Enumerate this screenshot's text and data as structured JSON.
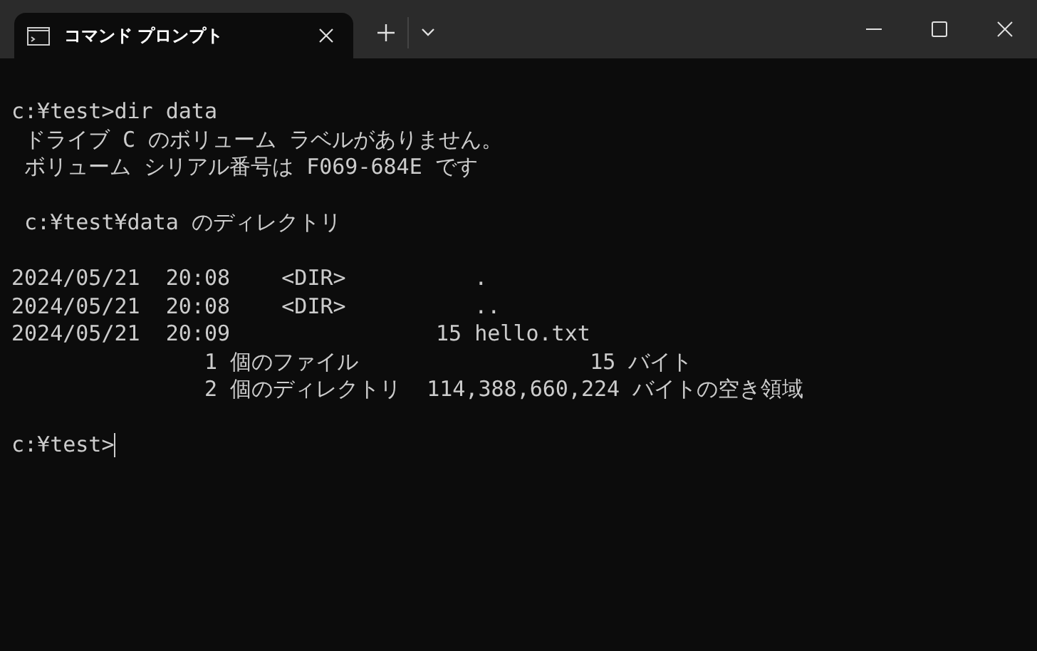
{
  "tabs": [
    {
      "title": "コマンド プロンプト",
      "selected": true
    }
  ],
  "terminal": {
    "blocks": [
      [
        "c:¥test>dir data",
        " ドライブ C のボリューム ラベルがありません。",
        " ボリューム シリアル番号は F069-684E です"
      ],
      [
        " c:¥test¥data のディレクトリ"
      ],
      [
        "2024/05/21  20:08    <DIR>          .",
        "2024/05/21  20:08    <DIR>          ..",
        "2024/05/21  20:09                15 hello.txt",
        "               1 個のファイル                  15 バイト",
        "               2 個のディレクトリ  114,388,660,224 バイトの空き領域"
      ],
      [
        "c:¥test>"
      ]
    ],
    "cursor": true
  }
}
